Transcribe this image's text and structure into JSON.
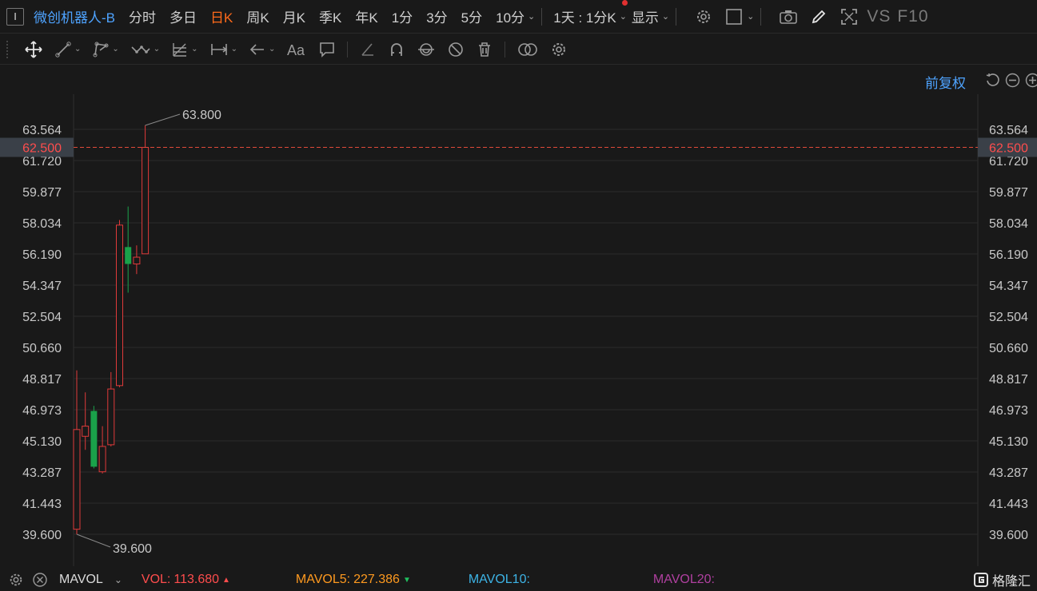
{
  "topbar": {
    "select_glyph": "I",
    "stock_name": "微创机器人-B",
    "periods": [
      "分时",
      "多日",
      "日K",
      "周K",
      "月K",
      "季K",
      "年K",
      "1分",
      "3分",
      "5分",
      "10分"
    ],
    "active_period": "日K",
    "combo": "1天 : 1分K",
    "display": "显示",
    "vs_text": "VS",
    "f10_text": "F10"
  },
  "chart": {
    "adjust_label": "前复权",
    "y_ticks": [
      "63.564",
      "61.720",
      "59.877",
      "58.034",
      "56.190",
      "54.347",
      "52.504",
      "50.660",
      "48.817",
      "46.973",
      "45.130",
      "43.287",
      "41.443",
      "39.600"
    ],
    "current_price": "62.500",
    "high_label": "63.800",
    "low_label": "39.600",
    "colors": {
      "up": "#e03a3a",
      "down": "#1aa14a",
      "accent": "#ff6a1a",
      "link": "#4ea3ff"
    }
  },
  "chart_data": {
    "type": "candlestick",
    "ylim": [
      39.6,
      63.564
    ],
    "candles": [
      {
        "open": 39.9,
        "high": 49.3,
        "low": 39.6,
        "close": 45.8
      },
      {
        "open": 45.4,
        "high": 48.0,
        "low": 44.6,
        "close": 46.0
      },
      {
        "open": 46.9,
        "high": 47.2,
        "low": 43.5,
        "close": 43.6
      },
      {
        "open": 43.3,
        "high": 46.0,
        "low": 43.2,
        "close": 44.8
      },
      {
        "open": 44.9,
        "high": 49.2,
        "low": 44.8,
        "close": 48.2
      },
      {
        "open": 48.4,
        "high": 58.2,
        "low": 48.3,
        "close": 57.9
      },
      {
        "open": 56.6,
        "high": 59.0,
        "low": 53.9,
        "close": 55.6
      },
      {
        "open": 55.6,
        "high": 56.7,
        "low": 55.0,
        "close": 56.0
      },
      {
        "open": 56.2,
        "high": 63.8,
        "low": 56.2,
        "close": 62.5
      }
    ]
  },
  "bottombar": {
    "indicator": "MAVOL",
    "vol_label": "VOL:",
    "vol_value": "113.680",
    "ma5_label": "MAVOL5:",
    "ma5_value": "227.386",
    "ma10_label": "MAVOL10:",
    "ma20_label": "MAVOL20:",
    "logo_text": "格隆汇"
  }
}
